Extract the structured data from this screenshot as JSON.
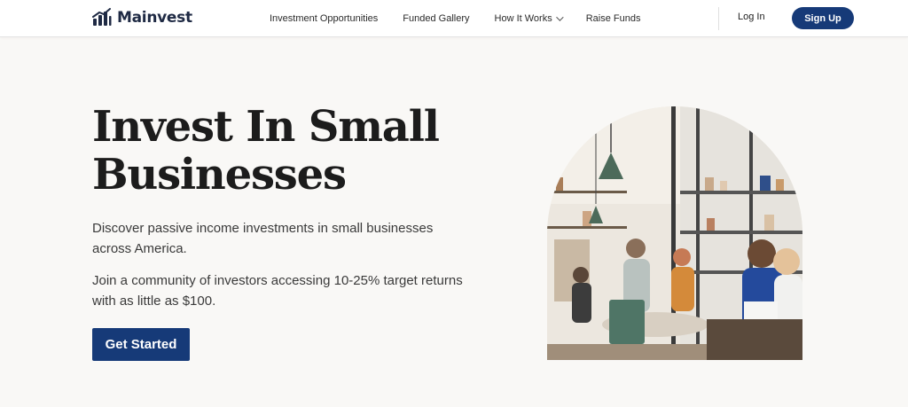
{
  "brand": {
    "name": "Mainvest",
    "icon": "bar-chart-logo-icon"
  },
  "nav": {
    "items": [
      {
        "label": "Investment Opportunities"
      },
      {
        "label": "Funded Gallery"
      },
      {
        "label": "How It Works",
        "dropdown": true
      },
      {
        "label": "Raise Funds"
      }
    ],
    "login_label": "Log In",
    "signup_label": "Sign Up"
  },
  "hero": {
    "title": "Invest In Small Businesses",
    "paragraph_1": "Discover passive income investments in small businesses across America.",
    "paragraph_2": "Join a community of investors accessing 10-25% target returns with as little as $100.",
    "cta_label": "Get Started",
    "image": "cafe-photo"
  },
  "colors": {
    "primary": "#163a78",
    "background": "#f9f8f6",
    "text": "#1c1c1c"
  }
}
